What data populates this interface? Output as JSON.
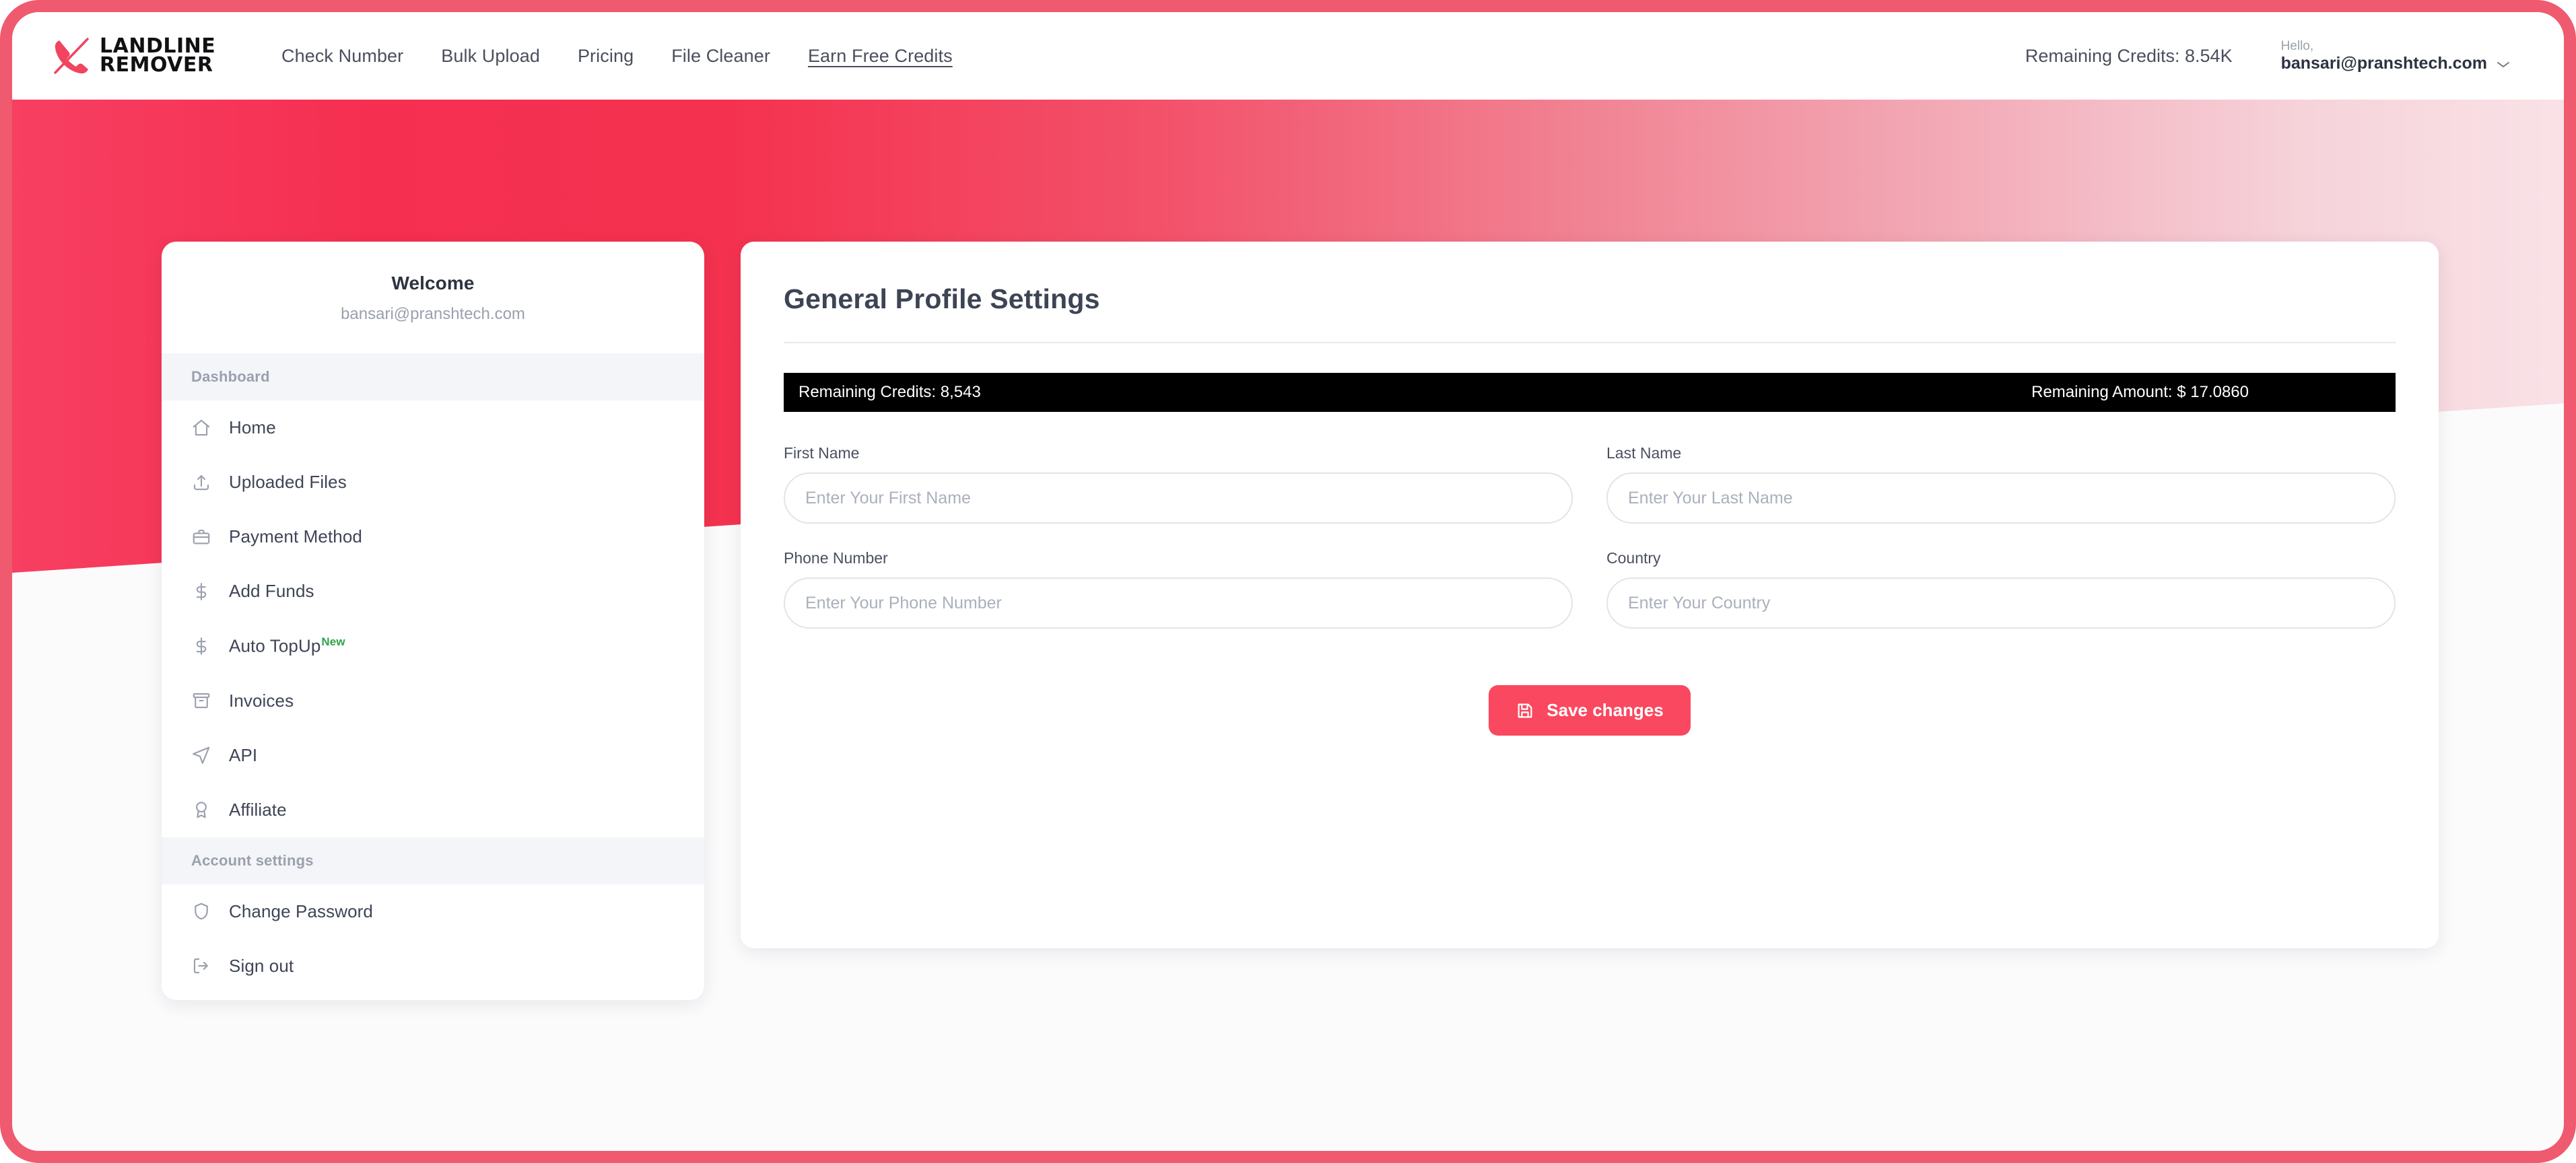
{
  "header": {
    "logo": {
      "icon": "phone-slash-icon",
      "line1": "LANDLINE",
      "line2": "REMOVER"
    },
    "nav": [
      {
        "label": "Check Number",
        "underlined": false
      },
      {
        "label": "Bulk Upload",
        "underlined": false
      },
      {
        "label": "Pricing",
        "underlined": false
      },
      {
        "label": "File Cleaner",
        "underlined": false
      },
      {
        "label": "Earn Free Credits",
        "underlined": true
      }
    ],
    "remaining_credits": "Remaining Credits: 8.54K",
    "hello_label": "Hello,",
    "account_email": "bansari@pranshtech.com",
    "chevron_icon": "chevron-down-icon"
  },
  "sidebar": {
    "welcome_title": "Welcome",
    "welcome_email": "bansari@pranshtech.com",
    "sections": [
      {
        "heading": "Dashboard",
        "items": [
          {
            "label": "Home",
            "icon": "home-icon",
            "badge": ""
          },
          {
            "label": "Uploaded Files",
            "icon": "upload-icon",
            "badge": ""
          },
          {
            "label": "Payment Method",
            "icon": "briefcase-icon",
            "badge": ""
          },
          {
            "label": "Add Funds",
            "icon": "dollar-icon",
            "badge": ""
          },
          {
            "label": "Auto TopUp",
            "icon": "dollar-icon",
            "badge": "New"
          },
          {
            "label": "Invoices",
            "icon": "archive-icon",
            "badge": ""
          },
          {
            "label": "API",
            "icon": "send-icon",
            "badge": ""
          },
          {
            "label": "Affiliate",
            "icon": "award-icon",
            "badge": ""
          }
        ]
      },
      {
        "heading": "Account settings",
        "items": [
          {
            "label": "Change Password",
            "icon": "shield-icon",
            "badge": ""
          },
          {
            "label": "Sign out",
            "icon": "logout-icon",
            "badge": ""
          }
        ]
      }
    ]
  },
  "main": {
    "title": "General Profile Settings",
    "stats": {
      "credits": "Remaining Credits: 8,543",
      "amount": "Remaining Amount: $ 17.0860"
    },
    "fields": [
      {
        "label": "First Name",
        "placeholder": "Enter Your First Name",
        "value": ""
      },
      {
        "label": "Last Name",
        "placeholder": "Enter Your Last Name",
        "value": ""
      },
      {
        "label": "Phone Number",
        "placeholder": "Enter Your Phone Number",
        "value": ""
      },
      {
        "label": "Country",
        "placeholder": "Enter Your Country",
        "value": ""
      }
    ],
    "save_label": "Save changes",
    "save_icon": "save-disk-icon"
  },
  "colors": {
    "brand_pink": "#f9485f",
    "frame_border": "#ef5a6f",
    "hero_start": "#f73f62",
    "hero_end": "#f9e2e7",
    "badge_green": "#2fa34a",
    "stats_bar": "#000000"
  }
}
